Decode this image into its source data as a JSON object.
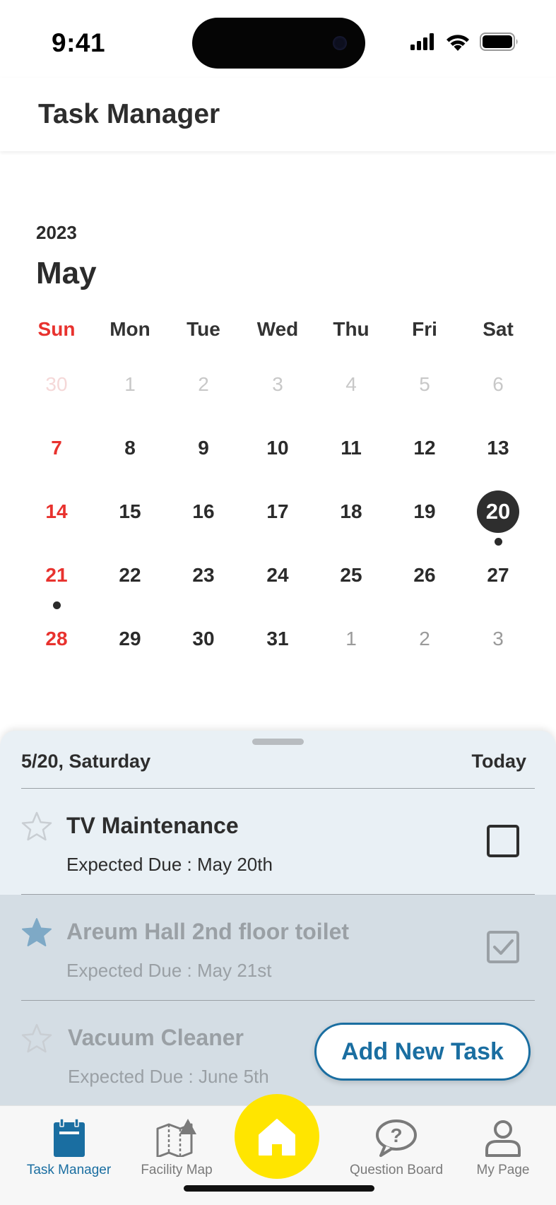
{
  "status_bar": {
    "time": "9:41"
  },
  "header": {
    "title": "Task Manager"
  },
  "calendar": {
    "year": "2023",
    "month": "May",
    "weekdays": [
      "Sun",
      "Mon",
      "Tue",
      "Wed",
      "Thu",
      "Fri",
      "Sat"
    ],
    "weeks": [
      [
        {
          "d": "30",
          "kind": "prev"
        },
        {
          "d": "1",
          "kind": "dim"
        },
        {
          "d": "2",
          "kind": "dim"
        },
        {
          "d": "3",
          "kind": "dim"
        },
        {
          "d": "4",
          "kind": "dim"
        },
        {
          "d": "5",
          "kind": "dim"
        },
        {
          "d": "6",
          "kind": "dim"
        }
      ],
      [
        {
          "d": "7"
        },
        {
          "d": "8"
        },
        {
          "d": "9"
        },
        {
          "d": "10"
        },
        {
          "d": "11"
        },
        {
          "d": "12"
        },
        {
          "d": "13"
        }
      ],
      [
        {
          "d": "14"
        },
        {
          "d": "15"
        },
        {
          "d": "16"
        },
        {
          "d": "17"
        },
        {
          "d": "18"
        },
        {
          "d": "19"
        },
        {
          "d": "20",
          "selected": true,
          "event": true
        }
      ],
      [
        {
          "d": "21",
          "event": true
        },
        {
          "d": "22"
        },
        {
          "d": "23"
        },
        {
          "d": "24"
        },
        {
          "d": "25"
        },
        {
          "d": "26"
        },
        {
          "d": "27"
        }
      ],
      [
        {
          "d": "28"
        },
        {
          "d": "29"
        },
        {
          "d": "30"
        },
        {
          "d": "31"
        },
        {
          "d": "1",
          "kind": "out"
        },
        {
          "d": "2",
          "kind": "out"
        },
        {
          "d": "3",
          "kind": "out"
        }
      ]
    ]
  },
  "sheet": {
    "date_label": "5/20, Saturday",
    "today_label": "Today",
    "tasks": [
      {
        "title": "TV Maintenance",
        "due": "Expected Due : May 20th",
        "starred": false,
        "done": false
      },
      {
        "title": "Areum Hall 2nd floor toilet",
        "due": "Expected Due : May 21st",
        "starred": true,
        "done": true
      },
      {
        "title": "Vacuum Cleaner",
        "due": "Expected Due : June 5th",
        "starred": false,
        "done": true
      }
    ],
    "add_button": "Add New Task"
  },
  "nav": {
    "items": [
      {
        "label": "Task Manager",
        "icon": "clipboard-icon",
        "active": true
      },
      {
        "label": "Facility Map",
        "icon": "map-icon",
        "active": false
      },
      {
        "label": "Question Board",
        "icon": "question-bubble-icon",
        "active": false
      },
      {
        "label": "My Page",
        "icon": "person-icon",
        "active": false
      }
    ],
    "home_icon": "home-icon"
  },
  "colors": {
    "accent": "#1a6ea1",
    "sunday": "#e8322e",
    "home": "#ffe500",
    "star_filled": "#7ea9c6"
  }
}
